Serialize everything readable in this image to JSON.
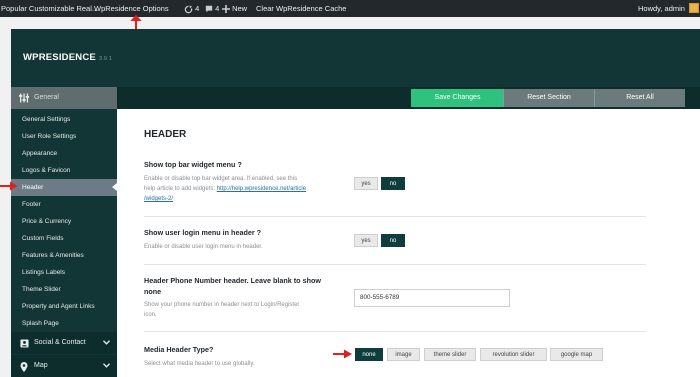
{
  "adminbar": {
    "site_title": "Popular Customizable Real...",
    "options_link": "WpResidence Options",
    "updates_count": "4",
    "comments_count": "4",
    "new_label": "New",
    "clear_cache": "Clear WpResidence Cache",
    "howdy": "Howdy, admin"
  },
  "header": {
    "logo": "WPRESIDENCE",
    "version": "3.9.1"
  },
  "toolbar": {
    "general_tab": "General",
    "save_label": "Save Changes",
    "reset_section_label": "Reset Section",
    "reset_all_label": "Reset All"
  },
  "sidebar": {
    "items": [
      {
        "label": "General Settings"
      },
      {
        "label": "User Role Settings"
      },
      {
        "label": "Appearance"
      },
      {
        "label": "Logos & Favicon"
      },
      {
        "label": "Header"
      },
      {
        "label": "Footer"
      },
      {
        "label": "Price & Currency"
      },
      {
        "label": "Custom Fields"
      },
      {
        "label": "Features & Amenities"
      },
      {
        "label": "Listings Labels"
      },
      {
        "label": "Theme Slider"
      },
      {
        "label": "Property and Agent Links"
      },
      {
        "label": "Splash Page"
      }
    ],
    "groups": [
      {
        "label": "Social & Contact"
      },
      {
        "label": "Map"
      }
    ]
  },
  "content": {
    "section_title": "HEADER",
    "rows": [
      {
        "title": "Show top bar widget menu ?",
        "desc_line1": "Enable or disable top bar widget area. If enabled, see this",
        "desc_line2": "help article to add widgets:",
        "link_part1": "http://help.wpresidence.net/article",
        "link_part2": "/widgets-2/",
        "yes": "yes",
        "no": "no"
      },
      {
        "title": "Show user login menu in header ?",
        "desc": "Enable or disable user login menu in header.",
        "yes": "yes",
        "no": "no"
      },
      {
        "title_line1": "Header Phone Number header. Leave blank to show",
        "title_line2": "none",
        "desc_line1": "Show your phone number in header next to Login/Register",
        "desc_line2": "icon.",
        "value": "800-555-6789"
      },
      {
        "title": "Media Header Type?",
        "desc": "Select what media header to use globally.",
        "options": [
          "none",
          "image",
          "theme slider",
          "revolution slider",
          "google map"
        ]
      }
    ]
  },
  "colors": {
    "accent": "#113635",
    "save_green": "#2ec27e",
    "toggle_on": "#0f3c3c",
    "arrow_red": "#e02020"
  }
}
